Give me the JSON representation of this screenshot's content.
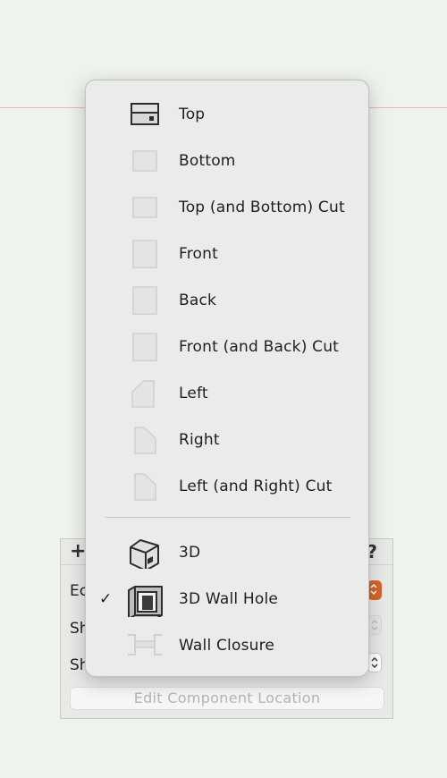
{
  "background_panel": {
    "add_symbol": "+",
    "help_symbol": "?",
    "rows": [
      {
        "label_fragment": "Ec"
      },
      {
        "label_fragment": "Sh"
      },
      {
        "label_fragment": "Sh"
      }
    ],
    "edit_location_button": "Edit Component Location"
  },
  "menu": {
    "items": [
      {
        "label": "Top",
        "icon": "top-view-icon",
        "checked": false
      },
      {
        "label": "Bottom",
        "icon": "bottom-view-icon",
        "checked": false
      },
      {
        "label": "Top (and Bottom) Cut",
        "icon": "top-bottom-cut-icon",
        "checked": false
      },
      {
        "label": "Front",
        "icon": "front-view-icon",
        "checked": false
      },
      {
        "label": "Back",
        "icon": "back-view-icon",
        "checked": false
      },
      {
        "label": "Front (and Back) Cut",
        "icon": "front-back-cut-icon",
        "checked": false
      },
      {
        "label": "Left",
        "icon": "left-view-icon",
        "checked": false
      },
      {
        "label": "Right",
        "icon": "right-view-icon",
        "checked": false
      },
      {
        "label": "Left (and Right) Cut",
        "icon": "left-right-cut-icon",
        "checked": false
      },
      {
        "label": "3D",
        "icon": "3d-house-icon",
        "checked": false
      },
      {
        "label": "3D Wall Hole",
        "icon": "3d-wall-hole-icon",
        "checked": true
      },
      {
        "label": "Wall Closure",
        "icon": "wall-closure-icon",
        "checked": false
      }
    ],
    "check_glyph": "✓"
  },
  "colors": {
    "accent_orange": "#d5652b",
    "guide_line": "#e9b6a9",
    "background": "#eff3ee"
  }
}
